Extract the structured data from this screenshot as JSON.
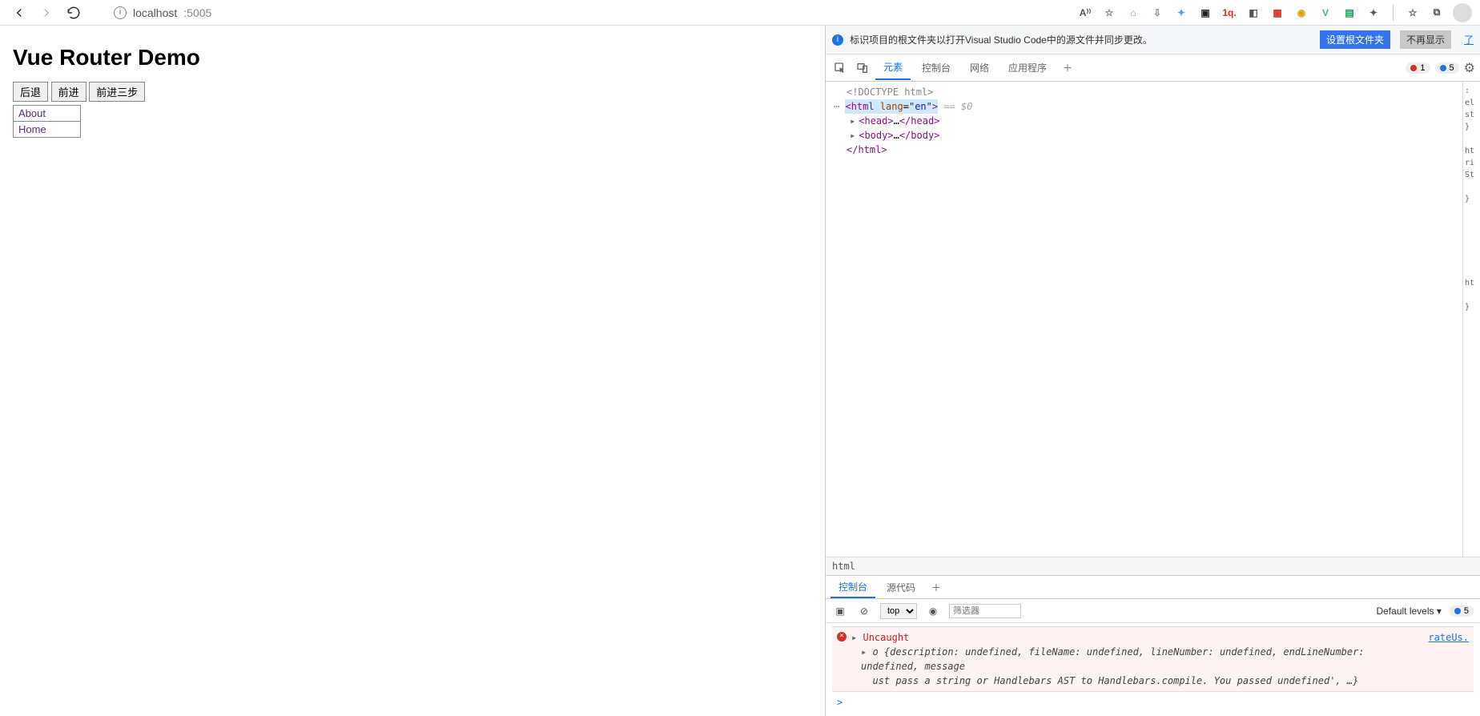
{
  "browser": {
    "url_host": "localhost",
    "url_port": ":5005",
    "read_aloud_label": "A⁾⁾",
    "extensions": [
      {
        "name": "bilibili",
        "glyph": "⌂",
        "color": "#e57ab0"
      },
      {
        "name": "download",
        "glyph": "⇩",
        "color": "#888"
      },
      {
        "name": "feiliao",
        "glyph": "✦",
        "color": "#4aa3e8"
      },
      {
        "name": "grid",
        "glyph": "▣",
        "color": "#222"
      },
      {
        "name": "oneq",
        "glyph": "1q.",
        "color": "#d93025"
      },
      {
        "name": "toggle",
        "glyph": "◧",
        "color": "#555"
      },
      {
        "name": "redbox",
        "glyph": "▩",
        "color": "#d93025"
      },
      {
        "name": "idm",
        "glyph": "◉",
        "color": "#e0a000"
      },
      {
        "name": "vue",
        "glyph": "V",
        "color": "#41b883"
      },
      {
        "name": "sheet",
        "glyph": "▤",
        "color": "#0f9d58"
      },
      {
        "name": "ext",
        "glyph": "✦",
        "color": "#555"
      }
    ]
  },
  "page": {
    "title": "Vue Router Demo",
    "buttons": {
      "back": "后退",
      "forward": "前进",
      "forward3": "前进三步"
    },
    "links": {
      "about": "About",
      "home": "Home"
    }
  },
  "devtools": {
    "notification": {
      "text": "标识项目的根文件夹以打开Visual Studio Code中的源文件并同步更改。",
      "primary_btn": "设置根文件夹",
      "secondary_btn": "不再显示",
      "link": "了"
    },
    "tabs": {
      "elements": "元素",
      "console": "控制台",
      "network": "网络",
      "application": "应用程序"
    },
    "status": {
      "errors": "1",
      "warnings": "5"
    },
    "dom": {
      "doctype": "<!DOCTYPE html>",
      "html_open": "<html lang=\"en\">",
      "eq0": "== $0",
      "head": "<head>…</head>",
      "body": "<body>…</body>",
      "html_close": "</html>"
    },
    "styles_strip": ":\nel\nst\n}\n\nht\nri\nSt\n\n}\n\n\n\n\n\n\nht\n\n}",
    "breadcrumb": "html",
    "console_tabs": {
      "console": "控制台",
      "sources": "源代码"
    },
    "console_toolbar": {
      "context": "top",
      "filter_placeholder": "筛选器",
      "levels": "Default levels",
      "issues": "5"
    },
    "console_error": {
      "label": "Uncaught",
      "line1": "o {description: undefined, fileName: undefined, lineNumber: undefined, endLineNumber: undefined, message",
      "line2": "ust pass a string or Handlebars AST to Handlebars.compile. You passed undefined', …}",
      "source": "rateUs."
    },
    "prompt": ">"
  }
}
